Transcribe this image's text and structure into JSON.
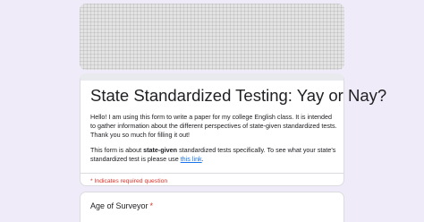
{
  "form": {
    "title": "State Standardized Testing: Yay or Nay?",
    "description": {
      "paragraph1": "Hello! I am using this form to write a paper for my college English class. It is intended to gather information about the different perspectives of state-given standardized tests. Thank you so much for filling it out!",
      "paragraph2_prefix": "This form is about ",
      "paragraph2_bold": "state-given",
      "paragraph2_middle": " standardized tests specifically. To see what your state's standardized test is please use ",
      "paragraph2_link": "this link",
      "paragraph2_suffix": "."
    },
    "required_note": "* Indicates required question"
  },
  "question": {
    "label": "Age of Surveyor",
    "required_mark": "*"
  }
}
